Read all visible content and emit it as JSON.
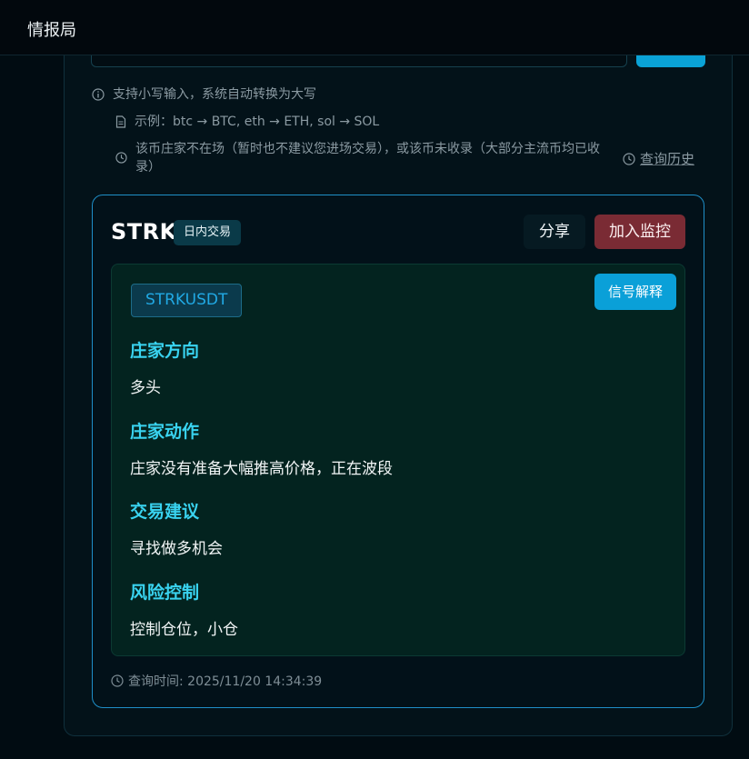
{
  "app": {
    "title": "情报局"
  },
  "hints": {
    "lowercase": "支持小写输入，系统自动转换为大写",
    "example": "示例：btc → BTC, eth → ETH, sol → SOL",
    "not_listed": "该币庄家不在场（暂时也不建议您进场交易），或该币未收录（大部分主流币均已收录）",
    "history_link": "查询历史"
  },
  "result": {
    "symbol": "STRK",
    "mode_badge": "日内交易",
    "share_label": "分享",
    "watch_label": "加入监控",
    "pair": "STRKUSDT",
    "explain_label": "信号解释",
    "sections": [
      {
        "title": "庄家方向",
        "value": "多头"
      },
      {
        "title": "庄家动作",
        "value": "庄家没有准备大幅推高价格，正在波段"
      },
      {
        "title": "交易建议",
        "value": "寻找做多机会"
      },
      {
        "title": "风险控制",
        "value": "控制仓位，小仓"
      }
    ],
    "query_time": "查询时间: 2025/11/20 14:34:39"
  },
  "colors": {
    "accent": "#0aa2d6",
    "watch_button": "#7a2b34",
    "section_title": "#39d3f0",
    "card_border": "#1f8fc8"
  }
}
